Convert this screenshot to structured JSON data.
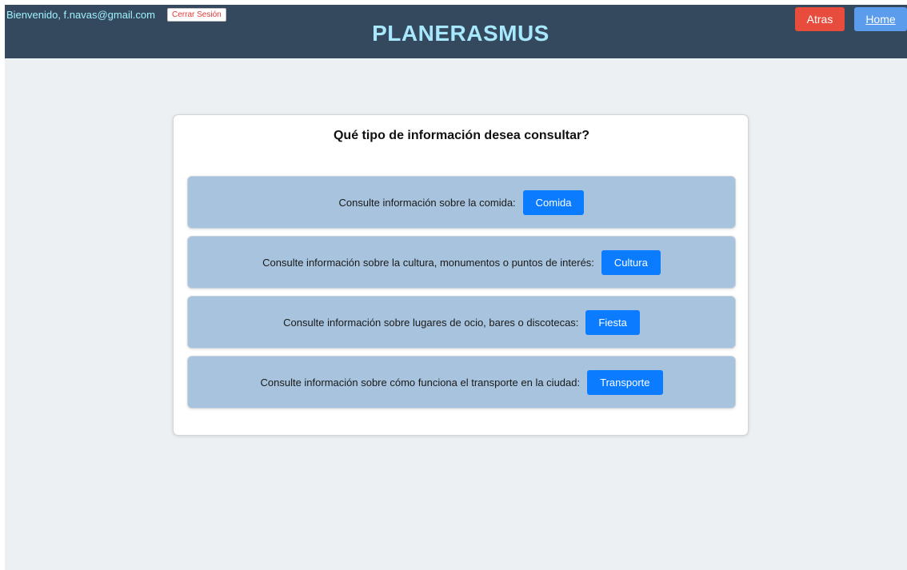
{
  "header": {
    "welcome": "Bienvenido, f.navas@gmail.com",
    "logout_label": "Cerrar Sesión",
    "brand": "PLANERASMUS",
    "back_label": "Atras",
    "home_label": "Home"
  },
  "card": {
    "title": "Qué tipo de información desea consultar?",
    "options": [
      {
        "text": "Consulte información sobre la comida:",
        "button": "Comida"
      },
      {
        "text": "Consulte información sobre la cultura, monumentos o puntos de interés:",
        "button": "Cultura"
      },
      {
        "text": "Consulte información sobre lugares de ocio, bares o discotecas:",
        "button": "Fiesta"
      },
      {
        "text": "Consulte información sobre cómo funciona el transporte en la ciudad:",
        "button": "Transporte"
      }
    ]
  },
  "colors": {
    "header_bg": "#34495e",
    "brand_text": "#a8e8ff",
    "welcome_text": "#9ff2ff",
    "back_button": "#e74c3c",
    "home_button": "#5b9ced",
    "option_bg": "#a7c3dd",
    "option_button": "#0b7bff",
    "page_bg": "#edf0f2"
  }
}
